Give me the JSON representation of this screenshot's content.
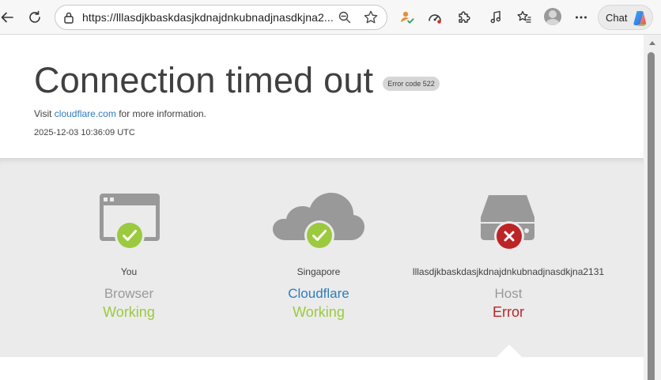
{
  "browser": {
    "url": "https://lllasdjkbaskdasjkdnajdnkubnadjnasdkjna2...",
    "chat_label": "Chat",
    "icons": [
      "back-icon",
      "refresh-icon",
      "lock-icon",
      "zoom-out-icon",
      "favorite-star-icon",
      "extension-badge-icon",
      "performance-gauge-icon",
      "extensions-puzzle-icon",
      "media-note-icon",
      "favorites-list-icon",
      "profile-avatar",
      "more-options-icon",
      "copilot-icon"
    ]
  },
  "page": {
    "title": "Connection timed out",
    "error_code": "Error code 522",
    "visit_prefix": "Visit",
    "visit_link": "cloudflare.com",
    "visit_suffix": "for more information.",
    "timestamp": "2025-12-03 10:36:09 UTC"
  },
  "status": [
    {
      "location": "You",
      "name": "Browser",
      "state": "Working",
      "result": "ok",
      "icon": "browser-window-icon"
    },
    {
      "location": "Singapore",
      "name": "Cloudflare",
      "state": "Working",
      "result": "ok",
      "icon": "cloud-icon"
    },
    {
      "location": "lllasdjkbaskdasjkdnajdnkubnadjnasdkjna2131",
      "name": "Host",
      "state": "Error",
      "result": "error",
      "icon": "server-icon"
    }
  ],
  "colors": {
    "working": "#9bca3e",
    "error": "#bd2426",
    "link": "#2f7bbf",
    "icon_gray": "#999999",
    "section_bg": "#ebebeb"
  }
}
